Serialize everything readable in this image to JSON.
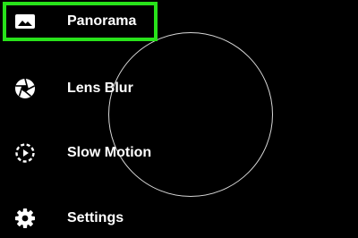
{
  "menu": {
    "items": [
      {
        "label": "Panorama",
        "icon": "panorama-icon"
      },
      {
        "label": "Lens Blur",
        "icon": "aperture-icon"
      },
      {
        "label": "Slow Motion",
        "icon": "slow-motion-icon"
      },
      {
        "label": "Settings",
        "icon": "gear-icon"
      }
    ],
    "selected_index": 0
  },
  "colors": {
    "background": "#000000",
    "text": "#ffffff",
    "highlight": "#28e21a",
    "ring": "#d8d8d8"
  }
}
